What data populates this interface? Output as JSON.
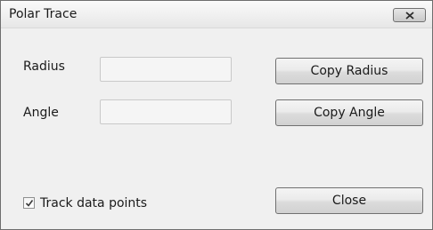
{
  "window": {
    "title": "Polar Trace"
  },
  "fields": {
    "radius": {
      "label": "Radius",
      "value": ""
    },
    "angle": {
      "label": "Angle",
      "value": ""
    }
  },
  "buttons": {
    "copy_radius": "Copy Radius",
    "copy_angle": "Copy Angle",
    "close": "Close"
  },
  "options": {
    "track_data_points": {
      "label": "Track data points",
      "checked": true
    }
  },
  "icons": {
    "close": "close-icon",
    "checkbox": "checkmark-icon"
  }
}
